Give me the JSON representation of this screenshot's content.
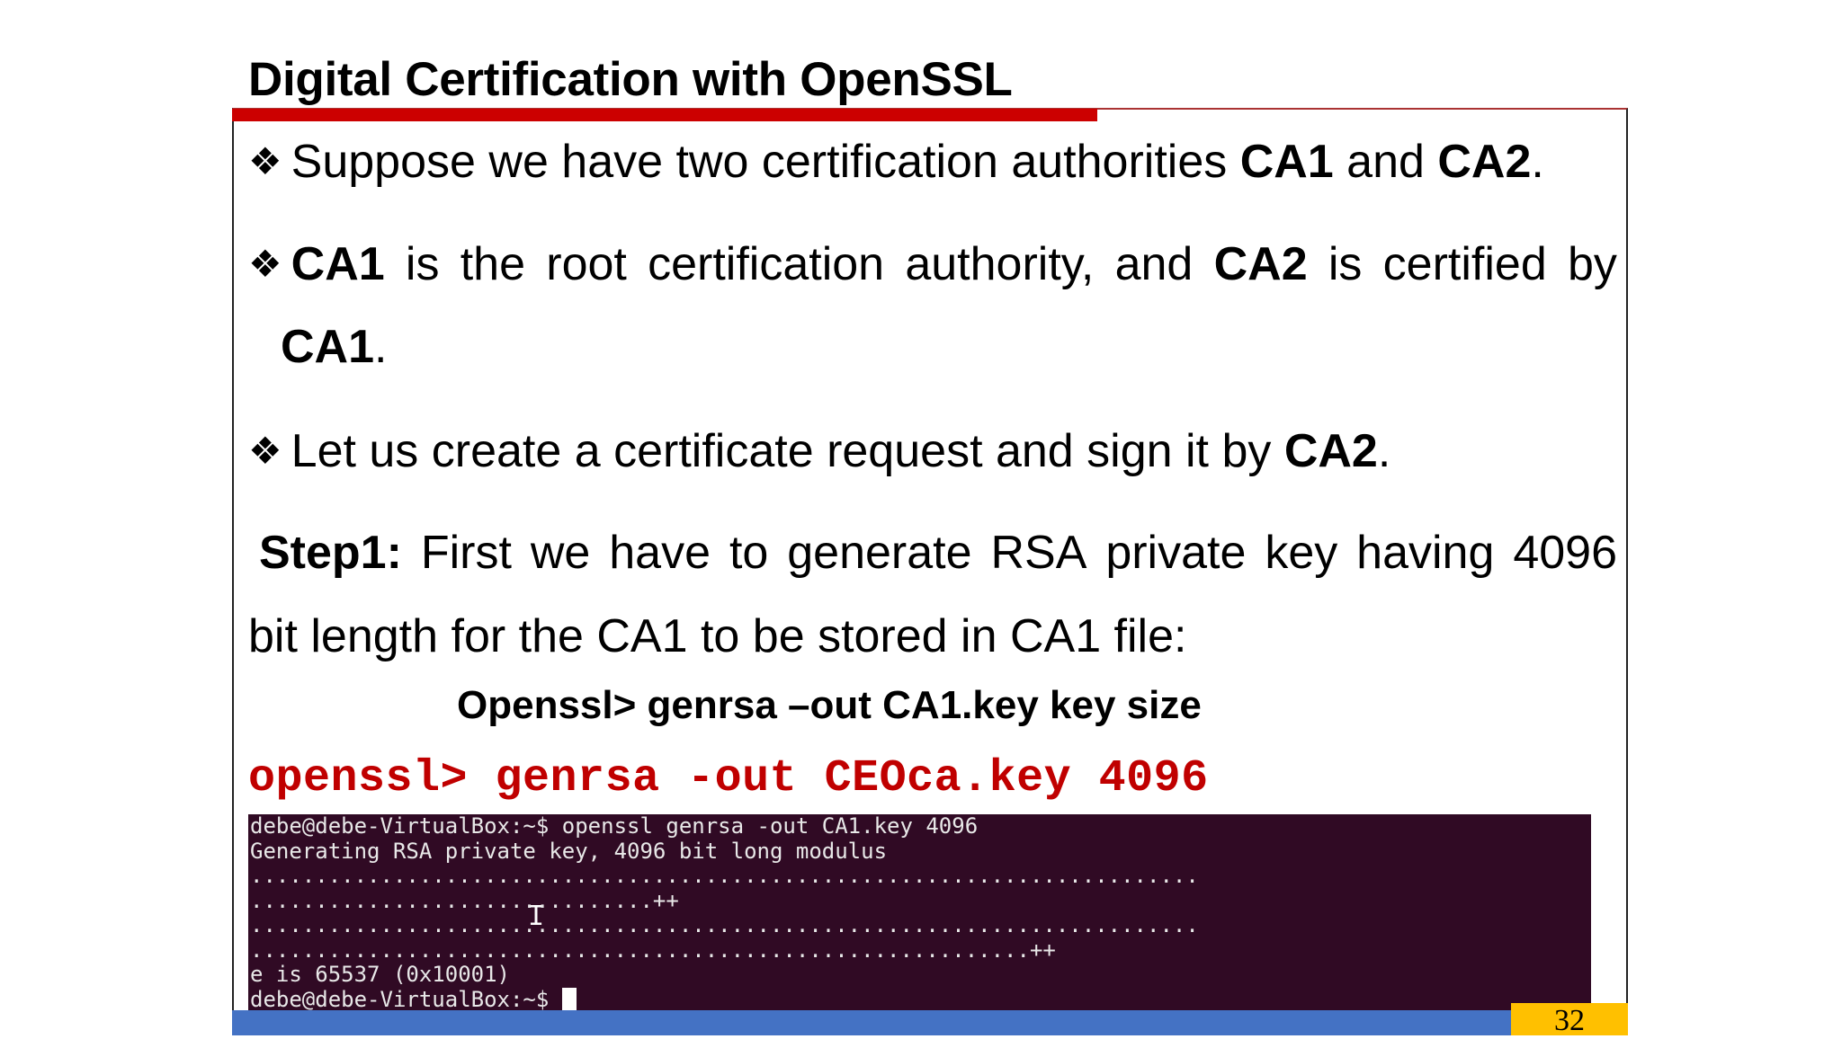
{
  "slide": {
    "title": "Digital Certification with OpenSSL",
    "bullet_glyph": "❖",
    "bullet1": {
      "pre": "Suppose we have two certification authorities ",
      "b1": "CA1",
      "mid": " and ",
      "b2": "CA2",
      "post": "."
    },
    "bullet2": {
      "b1": "CA1",
      "w1": "is",
      "w2": "the",
      "w3": "root",
      "w4": "certification",
      "w5": "authority,",
      "w6": "and",
      "b2": "CA2",
      "w7": "is",
      "w8": "certified",
      "w9": "by",
      "cont_bold": "CA1",
      "cont_post": "."
    },
    "bullet3": {
      "pre": "Let us create a certificate request and sign it by ",
      "b": "CA2",
      "post": "."
    },
    "step1": {
      "label": "Step1:",
      "w1": "First",
      "w2": "we",
      "w3": "have",
      "w4": "to",
      "w5": "generate",
      "w6": "RSA",
      "w7": "private",
      "w8": "key",
      "w9": "having",
      "w10": "4096",
      "line2": "bit length for the CA1 to be stored in CA1 file:"
    },
    "command_generic": "Openssl> genrsa –out CA1.key key size",
    "command_example": "openssl> genrsa -out CEOca.key 4096",
    "terminal": {
      "lines": [
        "debe@debe-VirtualBox:~$ openssl genrsa -out CA1.key 4096",
        "Generating RSA private key, 4096 bit long modulus",
        ".........................................................................",
        "...............................++",
        ".........................................................................",
        "............................................................++",
        "e is 65537 (0x10001)"
      ],
      "prompt": "debe@debe-VirtualBox:~$ "
    },
    "page_number": "32",
    "colors": {
      "accent_red": "#cc0000",
      "footer_blue": "#4472c4",
      "page_badge": "#ffc000",
      "terminal_bg": "#300a24"
    }
  }
}
